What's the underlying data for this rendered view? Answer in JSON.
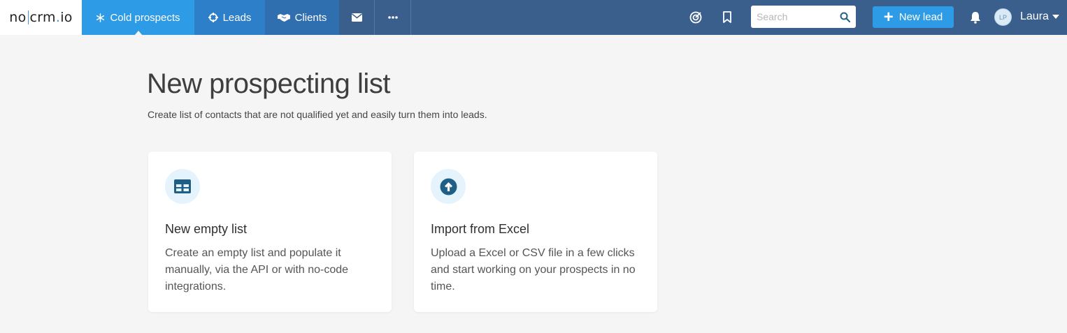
{
  "app": {
    "logo_text_left": "no",
    "logo_text_right": "crm",
    "logo_dot": ".",
    "logo_suffix": "io"
  },
  "nav": {
    "tabs": [
      {
        "label": "Cold prospects",
        "icon": "snowflake-icon",
        "active": true
      },
      {
        "label": "Leads",
        "icon": "crosshair-icon"
      },
      {
        "label": "Clients",
        "icon": "handshake-icon"
      },
      {
        "label": "",
        "icon": "envelope-icon"
      },
      {
        "label": "",
        "icon": "more-dots-icon"
      }
    ]
  },
  "header": {
    "search_placeholder": "Search",
    "new_lead_label": "New lead",
    "user_initials": "LP",
    "user_name": "Laura"
  },
  "main": {
    "title": "New prospecting list",
    "subtitle": "Create list of contacts that are not qualified yet and easily turn them into leads.",
    "cards": [
      {
        "icon": "table-icon",
        "title": "New empty list",
        "description": "Create an empty list and populate it manually, via the API or with no-code integrations."
      },
      {
        "icon": "upload-icon",
        "title": "Import from Excel",
        "description": "Upload a Excel or CSV file in a few clicks and start working on your prospects in no time."
      }
    ]
  },
  "colors": {
    "nav_bg": "#3a5f8c",
    "accent": "#2e9be6",
    "icon_dark": "#1f5f86",
    "page_bg": "#f5f5f5"
  }
}
